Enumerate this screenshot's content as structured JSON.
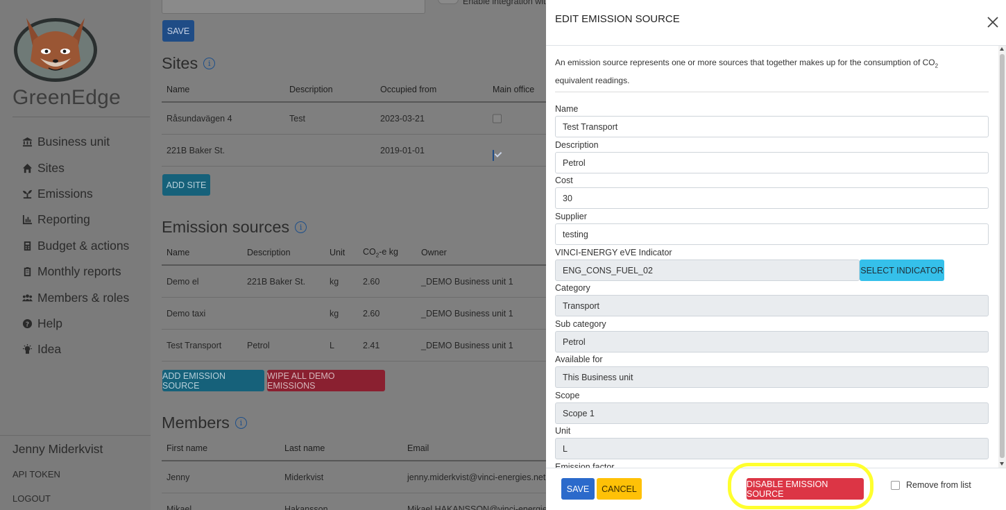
{
  "sidebar": {
    "brand": "GreenEdge",
    "nav": [
      {
        "label": "Business unit",
        "icon": "business-unit-icon"
      },
      {
        "label": "Sites",
        "icon": "home-icon"
      },
      {
        "label": "Emissions",
        "icon": "plant-icon"
      },
      {
        "label": "Reporting",
        "icon": "bar-chart-icon"
      },
      {
        "label": "Budget & actions",
        "icon": "calculator-icon"
      },
      {
        "label": "Monthly reports",
        "icon": "clipboard-icon"
      },
      {
        "label": "Members & roles",
        "icon": "users-icon"
      },
      {
        "label": "Help",
        "icon": "help-icon"
      },
      {
        "label": "Idea",
        "icon": "lightbulb-icon"
      }
    ],
    "user_name": "Jenny Miderkvist",
    "api_token": "API TOKEN",
    "logout": "LOGOUT"
  },
  "main": {
    "top_toggle_label": "Enable integration with",
    "save_label": "SAVE",
    "sites": {
      "title": "Sites",
      "columns": [
        "Name",
        "Description",
        "Occupied from",
        "Main office"
      ],
      "rows": [
        {
          "name": "Råsundavägen 4",
          "description": "Test",
          "occupied": "2023-03-21",
          "main_office": false
        },
        {
          "name": "221B Baker St.",
          "description": "",
          "occupied": "2019-01-01",
          "main_office": true
        }
      ],
      "add_label": "ADD SITE"
    },
    "emission_sources": {
      "title": "Emission sources",
      "columns": [
        "Name",
        "Description",
        "Unit",
        "CO",
        "2",
        "-e kg",
        "Owner"
      ],
      "rows": [
        {
          "name": "Demo el",
          "description": "221B Baker St.",
          "unit": "kg",
          "co2": "2.60",
          "owner": "_DEMO Business unit 1"
        },
        {
          "name": "Demo taxi",
          "description": "",
          "unit": "kg",
          "co2": "2.60",
          "owner": "_DEMO Business unit 1"
        },
        {
          "name": "Test Transport",
          "description": "Petrol",
          "unit": "L",
          "co2": "2.41",
          "owner": "_DEMO Business unit 1"
        }
      ],
      "add_label": "ADD EMISSION SOURCE",
      "wipe_label": "WIPE ALL DEMO EMISSIONS"
    },
    "members": {
      "title": "Members",
      "columns": [
        "First name",
        "Last name",
        "Email"
      ],
      "rows": [
        {
          "first": "Jenny",
          "last": "Miderkvist",
          "email": "jenny.miderkvist@vinci-energies.net"
        },
        {
          "first": "Mikael",
          "last": "Hakansson",
          "email": "Mikael.HAKANSSON@vinci-energies.net"
        }
      ]
    }
  },
  "modal": {
    "title": "EDIT EMISSION SOURCE",
    "intro_before": "An emission source represents one or more sources that together makes up for the consumption of CO",
    "intro_sub": "2",
    "intro_after": " equivalent readings.",
    "fields": {
      "name": {
        "label": "Name",
        "value": "Test Transport"
      },
      "description": {
        "label": "Description",
        "value": "Petrol"
      },
      "cost": {
        "label": "Cost",
        "value": "30"
      },
      "supplier": {
        "label": "Supplier",
        "value": "testing"
      },
      "indicator": {
        "label": "VINCI-ENERGY eVE Indicator",
        "value": "ENG_CONS_FUEL_02"
      },
      "category": {
        "label": "Category",
        "value": "Transport"
      },
      "sub_category": {
        "label": "Sub category",
        "value": "Petrol"
      },
      "available_for": {
        "label": "Available for",
        "value": "This Business unit"
      },
      "scope": {
        "label": "Scope",
        "value": "Scope 1"
      },
      "unit": {
        "label": "Unit",
        "value": "L"
      },
      "emission_factor": {
        "label": "Emission factor"
      }
    },
    "select_indicator_label": "SELECT INDICATOR",
    "save_label": "SAVE",
    "cancel_label": "CANCEL",
    "disable_label": "DISABLE EMISSION SOURCE",
    "remove_label": "Remove from list"
  },
  "colors": {
    "primary": "#2b6acb",
    "info": "#35c0ea",
    "warning": "#ffc107",
    "danger": "#dc3545",
    "highlight": "#ffff2e",
    "overlay": "#7f7f7f"
  }
}
